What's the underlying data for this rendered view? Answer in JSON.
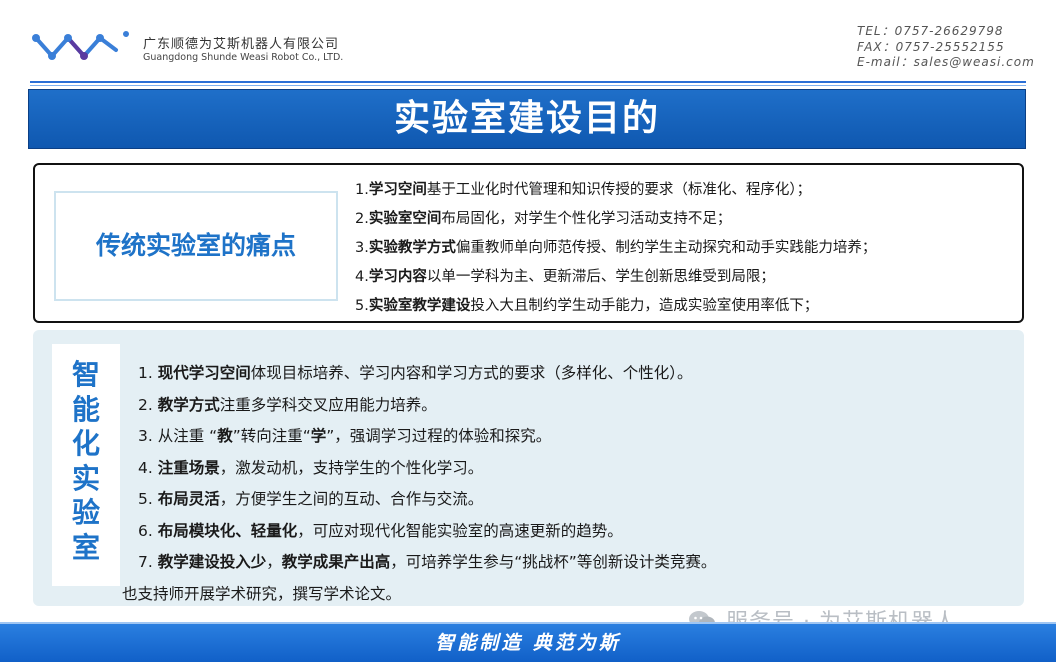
{
  "header": {
    "company_cn": "广东顺德为艾斯机器人有限公司",
    "company_en": "Guangdong Shunde Weasi Robot Co., LTD.",
    "tel": "TEL：0757-26629798",
    "fax": "FAX：0757-25552155",
    "email": "E-mail：sales@weasi.com"
  },
  "title": "实验室建设目的",
  "traditional": {
    "label": "传统实验室的痛点",
    "items": [
      {
        "num": "1.",
        "bold": "学习空间",
        "text": "基于工业化时代管理和知识传授的要求（标准化、程序化）；"
      },
      {
        "num": "2.",
        "bold": "实验室空间",
        "text": "布局固化，对学生个性化学习活动支持不足；"
      },
      {
        "num": "3.",
        "bold": "实验教学方式",
        "text": "偏重教师单向师范传授、制约学生主动探究和动手实践能力培养；"
      },
      {
        "num": "4.",
        "bold": "学习内容",
        "text": "以单一学科为主、更新滞后、学生创新思维受到局限；"
      },
      {
        "num": "5.",
        "bold": "实验室教学建设",
        "text": "投入大且制约学生动手能力，造成实验室使用率低下；"
      }
    ]
  },
  "smart": {
    "label": "智能化实验室",
    "items": [
      {
        "num": "1. ",
        "b1": "现代学习空间",
        "t1": "体现目标培养、学习内容和学习方式的要求（多样化、个性化）。"
      },
      {
        "num": "2. ",
        "b1": "教学方式",
        "t1": "注重多学科交叉应用能力培养。"
      },
      {
        "num": "3. ",
        "t0": "从注重 “",
        "b1": "教",
        "t1": "”转向注重“",
        "b2": "学",
        "t2": "”，强调学习过程的体验和探究。"
      },
      {
        "num": "4. ",
        "b1": "注重场景",
        "t1": "，激发动机，支持学生的个性化学习。"
      },
      {
        "num": "5. ",
        "b1": "布局灵活",
        "t1": "，方便学生之间的互动、合作与交流。"
      },
      {
        "num": "6. ",
        "b1": "布局模块化、轻量化",
        "t1": "，可应对现代化智能实验室的高速更新的趋势。"
      },
      {
        "num": "7.  ",
        "b1": "教学建设投入少",
        "t1": "，",
        "b2": "教学成果产出高",
        "t2": "，可培养学生参与“挑战杯”等创新设计类竞赛。"
      },
      {
        "num": "",
        "t0": "也支持师开展学术研究，撰写学术论文。"
      }
    ]
  },
  "watermark": "服务号 · 为艾斯机器人",
  "footer": "智能制造   典范为斯",
  "colors": {
    "brand_blue": "#1f6fc9",
    "label_blue": "#1e73c8",
    "panel_bg": "#e4eff4"
  }
}
